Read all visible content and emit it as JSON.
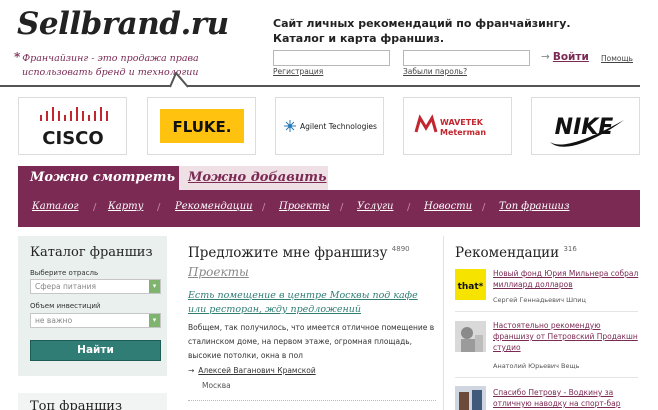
{
  "header": {
    "logo": "Sellbrand.ru",
    "tagline": "Франчайзинг - это продажа права использовать бренд и технологии",
    "site_desc_line1": "Сайт личных рекомендаций по франчайзингу.",
    "site_desc_line2": "Каталог и карта франшиз.",
    "register_link": "Регистрация",
    "forgot_link": "Забыли пароль?",
    "login_button": "Войти",
    "help_link": "Помощь"
  },
  "brands": [
    {
      "name": "CISCO"
    },
    {
      "name": "FLUKE."
    },
    {
      "name": "Agilent Technologies"
    },
    {
      "name": "WAVETEK",
      "sub": "Meterman"
    },
    {
      "name": "NIKE"
    }
  ],
  "tabs": {
    "active": "Можно смотреть",
    "inactive": "Можно добавить"
  },
  "nav": [
    "Каталог",
    "Карту",
    "Рекомендации",
    "Проекты",
    "Услуги",
    "Новости",
    "Топ франшиз"
  ],
  "catalog": {
    "title": "Каталог франшиз",
    "industry_label": "Выберите отрасль",
    "industry_placeholder": "Сфера питания",
    "investment_label": "Объем инвестиций",
    "investment_value": "не важно",
    "find_button": "Найти",
    "top_title": "Топ франшиз"
  },
  "offer": {
    "title": "Предложите мне франшизу",
    "count": "4890",
    "subtitle": "Проекты",
    "link": "Есть помещение в центре Москвы под кафе или ресторан, жду предложений",
    "text": "Вобщем, так получилось, что имеется отличное помещение в сталинском доме, на первом этаже, огромная площадь, высокие потолки, окна в пол",
    "author": "Алексей Ваганович Крамской",
    "city": "Москва"
  },
  "recommendations": {
    "title": "Рекомендации",
    "count": "316",
    "items": [
      {
        "text": "Новый фонд Юрия Мильнера собрал миллиард долларов",
        "author": "Сергей Геннадьевич Шпиц",
        "thumb": "that*"
      },
      {
        "text": "Настоятельно рекомендую франшизу от Петровский Продакшн студио",
        "author": "Анатолий Юрьевич Вещь"
      },
      {
        "text": "Спасибо Петрову - Водкину за отличную наводку на спорт-бар",
        "author": ""
      }
    ]
  },
  "colors": {
    "accent": "#7b2a54",
    "accent_light": "#efe0e5",
    "teal": "#2f7d74",
    "panel": "#e9f0ee"
  }
}
